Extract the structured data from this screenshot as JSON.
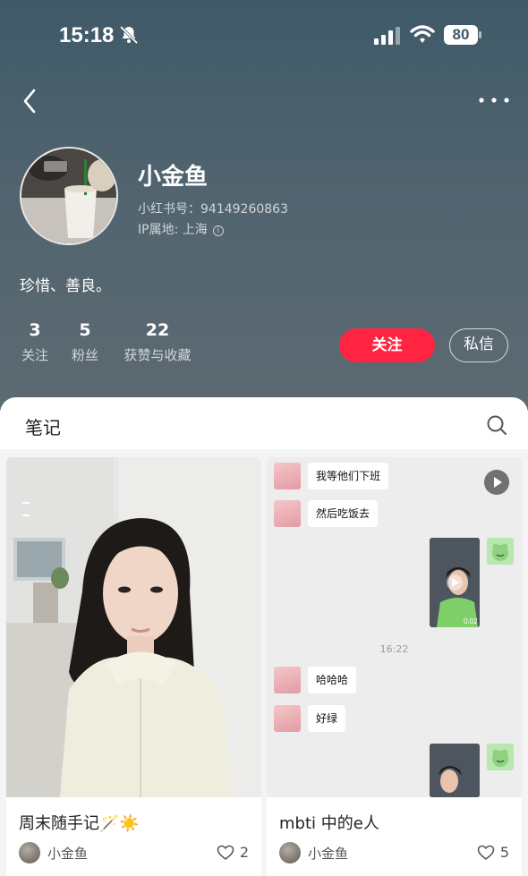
{
  "status_bar": {
    "time": "15:18",
    "battery": "80",
    "icons": [
      "bell-slash-icon",
      "signal-icon",
      "wifi-icon",
      "battery-icon"
    ]
  },
  "nav": {
    "back_icon": "chevron-left-icon",
    "more_icon": "more-horizontal-icon"
  },
  "profile": {
    "name": "小金鱼",
    "id_line": "小红书号：94149260863",
    "ip_line": "IP属地: 上海",
    "bio": "珍惜、善良。",
    "stats": [
      {
        "num": "3",
        "label": "关注"
      },
      {
        "num": "5",
        "label": "粉丝"
      },
      {
        "num": "22",
        "label": "获赞与收藏"
      }
    ],
    "follow_label": "关注",
    "message_label": "私信"
  },
  "notes": {
    "title": "笔记",
    "search_icon": "search-icon",
    "cards": [
      {
        "title": "周末随手记🪄☀️",
        "author": "小金鱼",
        "likes": "2"
      },
      {
        "title": "mbti 中的e人",
        "author": "小金鱼",
        "likes": "5"
      }
    ],
    "chat": {
      "messages": [
        "我等他们下班",
        "然后吃饭去",
        "哈哈哈",
        "好绿"
      ],
      "time": "16:22",
      "video_duration": "0:02"
    }
  },
  "colors": {
    "accent": "#ff2442",
    "header_top": "#3f5968",
    "header_bottom": "#5d6a72"
  }
}
